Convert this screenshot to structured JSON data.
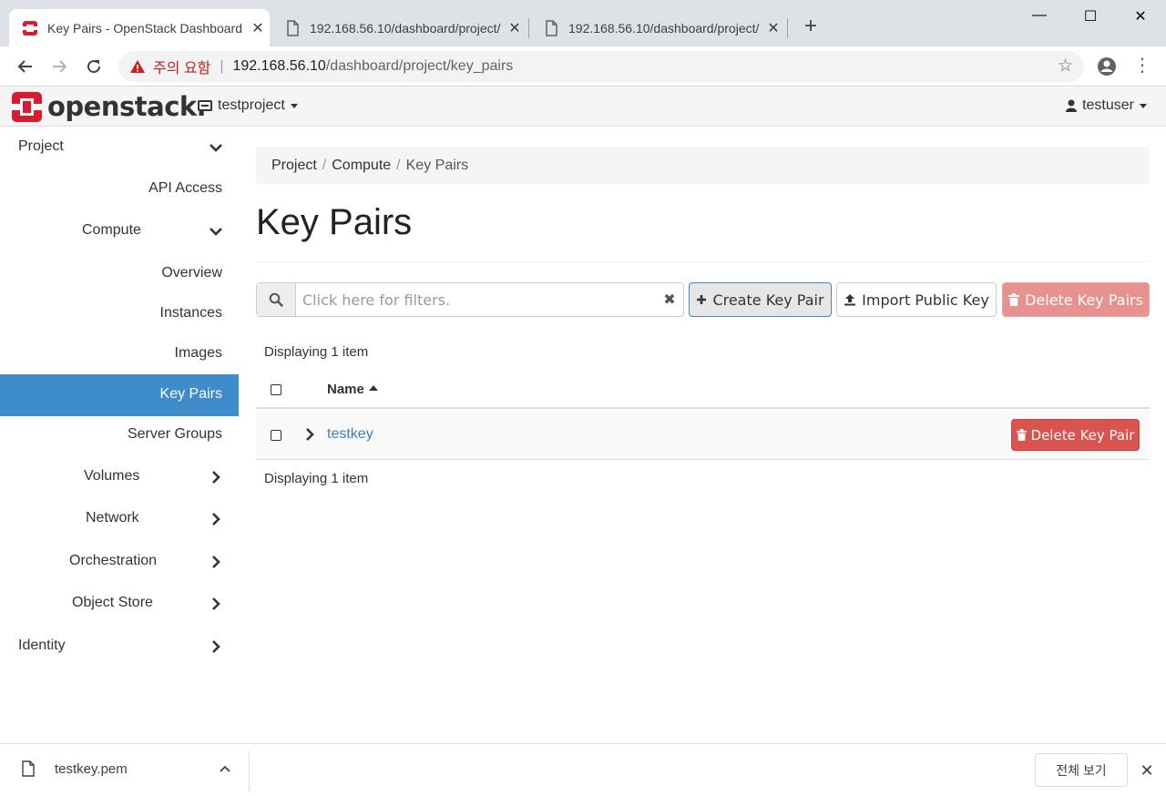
{
  "browser": {
    "tabs": [
      {
        "title": "Key Pairs - OpenStack Dashboard",
        "active": true
      },
      {
        "title": "192.168.56.10/dashboard/project/",
        "active": false
      },
      {
        "title": "192.168.56.10/dashboard/project/",
        "active": false
      }
    ],
    "new_tab": "+",
    "window": {
      "minimize": "—",
      "maximize": "☐",
      "close": "✕"
    },
    "address": {
      "warning": "주의 요함",
      "separator": "|",
      "host": "192.168.56.10",
      "path": "/dashboard/project/key_pairs"
    }
  },
  "header": {
    "brand": "openstack",
    "brand_dot": ".",
    "project": "testproject",
    "user": "testuser"
  },
  "sidebar": {
    "items": [
      {
        "label": "Project",
        "chevron": "down"
      },
      {
        "label": "API Access"
      },
      {
        "label": "Compute",
        "chevron": "down"
      },
      {
        "label": "Overview"
      },
      {
        "label": "Instances"
      },
      {
        "label": "Images"
      },
      {
        "label": "Key Pairs",
        "active": true
      },
      {
        "label": "Server Groups"
      },
      {
        "label": "Volumes",
        "chevron": "right"
      },
      {
        "label": "Network",
        "chevron": "right"
      },
      {
        "label": "Orchestration",
        "chevron": "right"
      },
      {
        "label": "Object Store",
        "chevron": "right"
      },
      {
        "label": "Identity",
        "chevron": "right"
      }
    ]
  },
  "breadcrumb": {
    "items": [
      "Project",
      "Compute",
      "Key Pairs"
    ],
    "separator": "/"
  },
  "page": {
    "title": "Key Pairs"
  },
  "filter": {
    "placeholder": "Click here for filters.",
    "clear": "✖"
  },
  "actions": {
    "create": "Create Key Pair",
    "import": "Import Public Key",
    "delete_all": "Delete Key Pairs"
  },
  "table": {
    "count_top": "Displaying 1 item",
    "count_bottom": "Displaying 1 item",
    "columns": [
      "Name"
    ],
    "rows": [
      {
        "name": "testkey",
        "action": "Delete Key Pair"
      }
    ]
  },
  "downloads": {
    "file": "testkey.pem",
    "show_all": "전체 보기",
    "close": "✕"
  },
  "colors": {
    "brand_red": "#da1a32",
    "sidebar_active": "#3f8ccb",
    "danger": "#d9534f",
    "link": "#3f7fb5"
  }
}
